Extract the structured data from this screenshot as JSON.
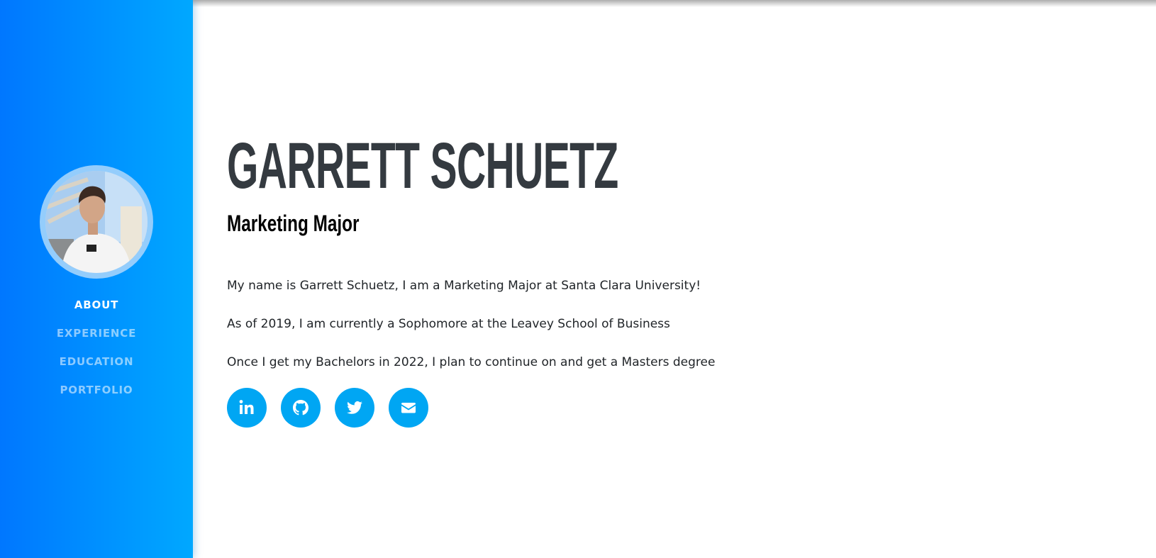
{
  "profile": {
    "name": "GARRETT SCHUETZ",
    "subtitle": "Marketing Major",
    "avatar_alt": "Profile photo"
  },
  "nav": {
    "items": [
      {
        "label": "ABOUT",
        "active": true
      },
      {
        "label": "EXPERIENCE",
        "active": false
      },
      {
        "label": "EDUCATION",
        "active": false
      },
      {
        "label": "PORTFOLIO",
        "active": false
      }
    ]
  },
  "about": {
    "paragraphs": [
      "My name is Garrett Schuetz, I am a Marketing Major at Santa Clara University!",
      "As of 2019, I am currently a Sophomore at the Leavey School of Business",
      "Once I get my Bachelors in 2022, I plan to continue on and get a Masters degree"
    ]
  },
  "socials": [
    {
      "icon": "linkedin-icon"
    },
    {
      "icon": "github-icon"
    },
    {
      "icon": "twitter-icon"
    },
    {
      "icon": "envelope-icon"
    }
  ],
  "colors": {
    "sidebar_start": "#0077ff",
    "sidebar_end": "#00a8ff",
    "heading": "#343a40",
    "social_button": "#00a6f3"
  }
}
